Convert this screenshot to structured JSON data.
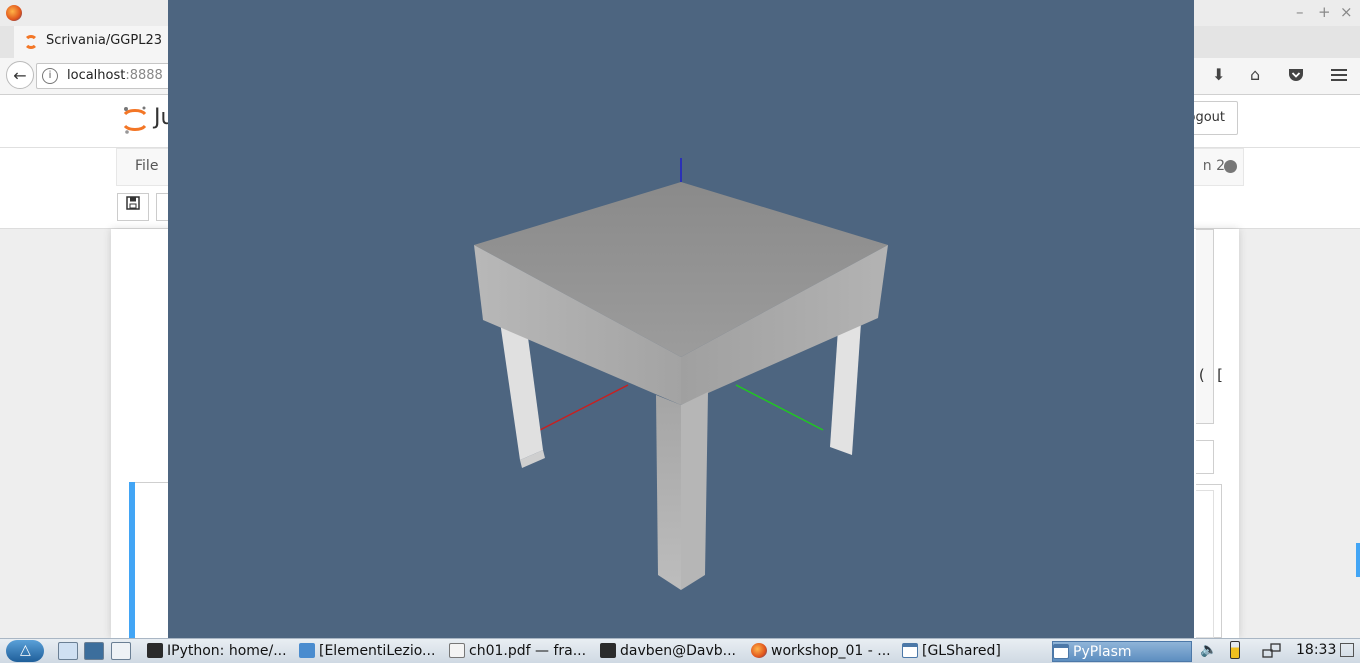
{
  "browser": {
    "tab_title": "Scrivania/GGPL23",
    "url_host": "localhost",
    "url_port": ":8888",
    "window_controls": {
      "minimize": "–",
      "maximize": "+",
      "close": "×"
    }
  },
  "jupyter": {
    "logo_text": "Ju",
    "logout_label": "Logout",
    "menu_file": "File",
    "kernel_label": "n 2",
    "cell_text": "( [",
    "save_icon": "floppy-disk-icon"
  },
  "viewer": {
    "title": "PyPlasm",
    "background_color": "#4d6580",
    "table_color": "#a8a8a8",
    "axes": {
      "x_color": "#cc2222",
      "y_color": "#22cc22",
      "z_color": "#2222cc"
    }
  },
  "taskbar": {
    "tasks": [
      {
        "label": "IPython: home/...",
        "icon": "terminal-icon"
      },
      {
        "label": "[ElementiLezio...",
        "icon": "folder-icon"
      },
      {
        "label": "ch01.pdf — fra...",
        "icon": "document-icon"
      },
      {
        "label": "davben@Davb...",
        "icon": "terminal-icon"
      },
      {
        "label": "workshop_01 - ...",
        "icon": "firefox-icon"
      },
      {
        "label": "[GLShared]",
        "icon": "window-icon"
      },
      {
        "label": "PyPlasm",
        "icon": "window-icon"
      }
    ],
    "clock": "18:33"
  }
}
